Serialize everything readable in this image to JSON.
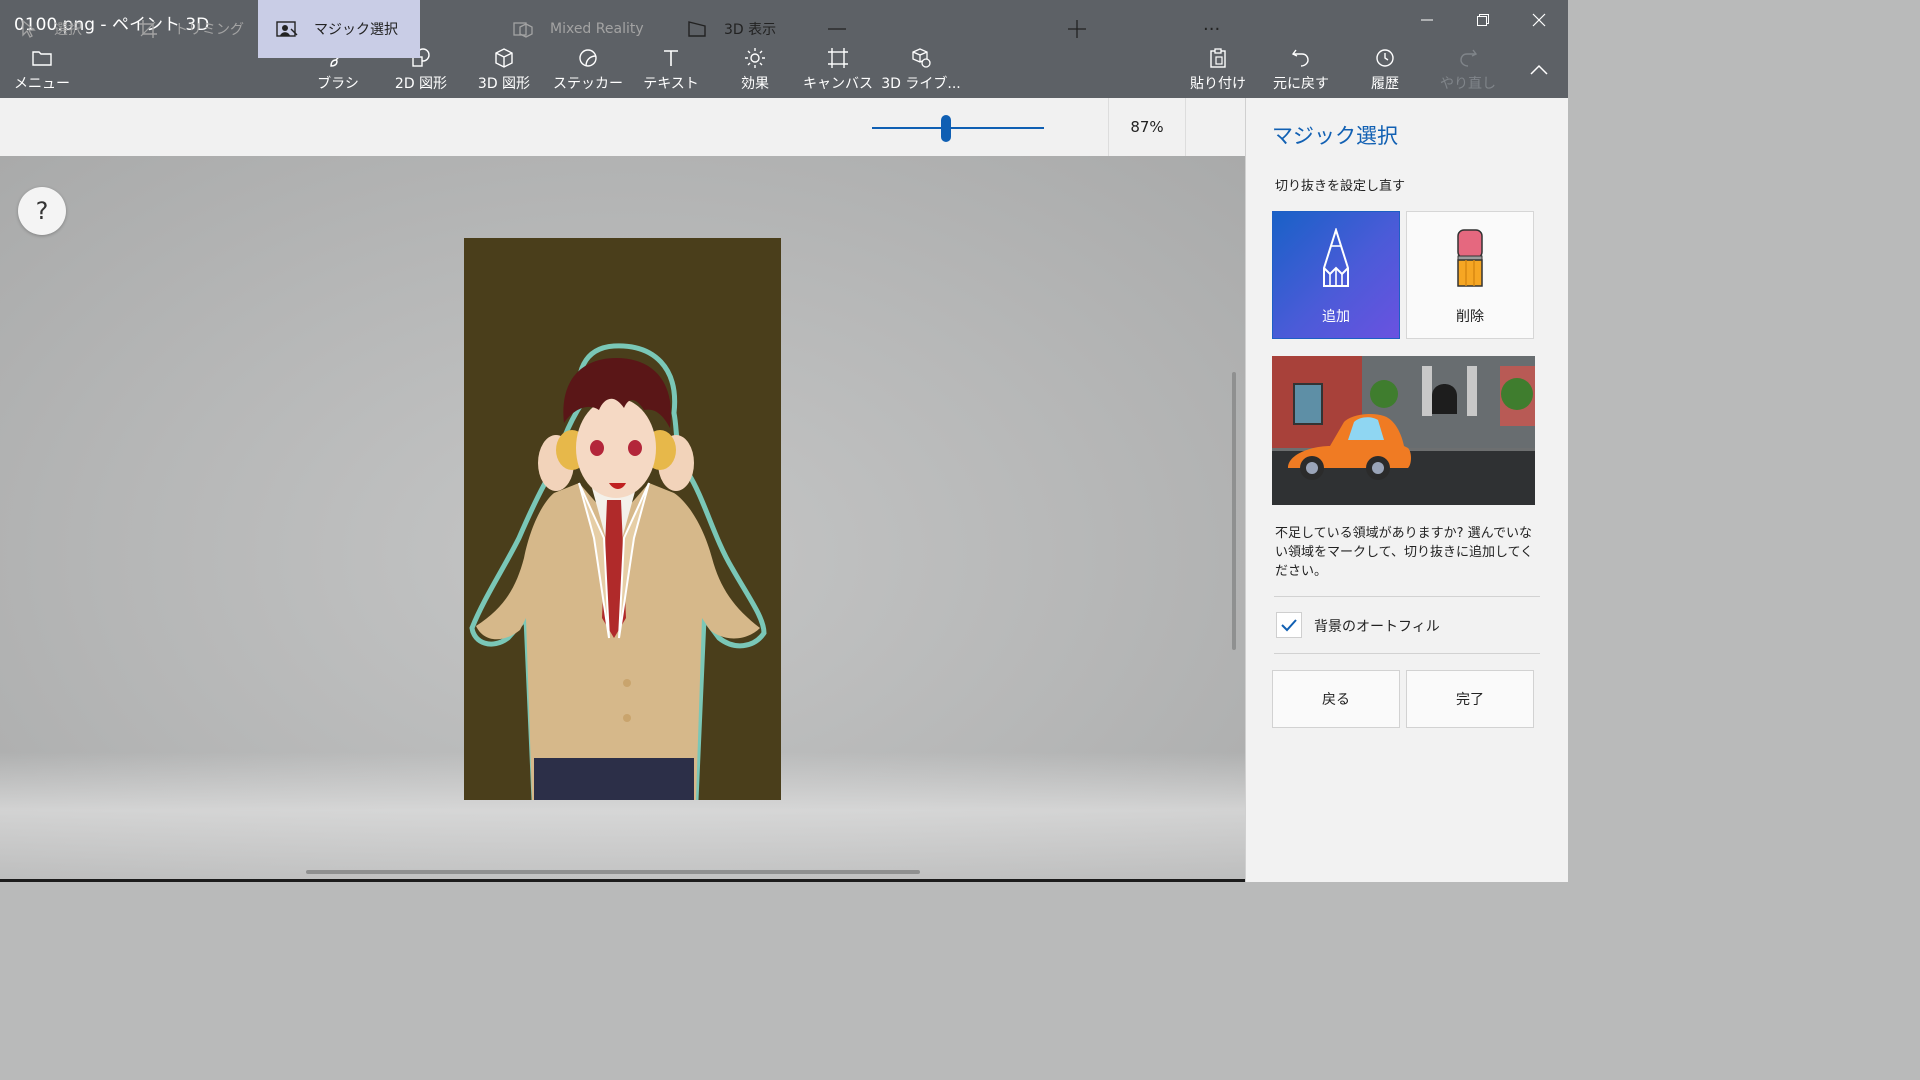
{
  "window": {
    "title": "0100.png - ペイント 3D",
    "minimize_icon": "minimize-icon",
    "restore_icon": "restore-icon",
    "close_icon": "close-icon"
  },
  "toolbar": {
    "menu": {
      "label": "メニュー",
      "icon": "folder-icon"
    },
    "tools": [
      {
        "label": "ブラシ",
        "icon": "brush-icon"
      },
      {
        "label": "2D 図形",
        "icon": "2d-shapes-icon"
      },
      {
        "label": "3D 図形",
        "icon": "3d-shapes-icon"
      },
      {
        "label": "ステッカー",
        "icon": "sticker-icon"
      },
      {
        "label": "テキスト",
        "icon": "text-icon"
      },
      {
        "label": "効果",
        "icon": "effects-icon"
      },
      {
        "label": "キャンバス",
        "icon": "canvas-icon"
      },
      {
        "label": "3D ライブ...",
        "icon": "3d-library-icon"
      }
    ],
    "right": {
      "paste": "貼り付け",
      "undo": "元に戻す",
      "history": "履歴",
      "redo": "やり直し"
    },
    "collapse_icon": "chevron-up-icon"
  },
  "subbar": {
    "select": "選択",
    "crop": "トリミング",
    "magic_select": "マジック選択",
    "mixed_reality": "Mixed Reality",
    "view_3d": "3D 表示",
    "zoom_percent": "87%",
    "zoom_level": 0.43,
    "more_icon": "more-icon"
  },
  "canvas": {
    "help": "?"
  },
  "panel": {
    "title": "マジック選択",
    "subtitle": "切り抜きを設定し直す",
    "add_label": "追加",
    "remove_label": "削除",
    "description": "不足している領域がありますか? 選んでいない領域をマークして、切り抜きに追加してください。",
    "autofill_label": "背景のオートフィル",
    "autofill_checked": true,
    "back_label": "戻る",
    "done_label": "完了"
  },
  "colors": {
    "titlebar": "#5d6166",
    "accent": "#1160b3",
    "selected_tool_bg": "#c9cde6",
    "image_bg": "#4a3e1b"
  }
}
